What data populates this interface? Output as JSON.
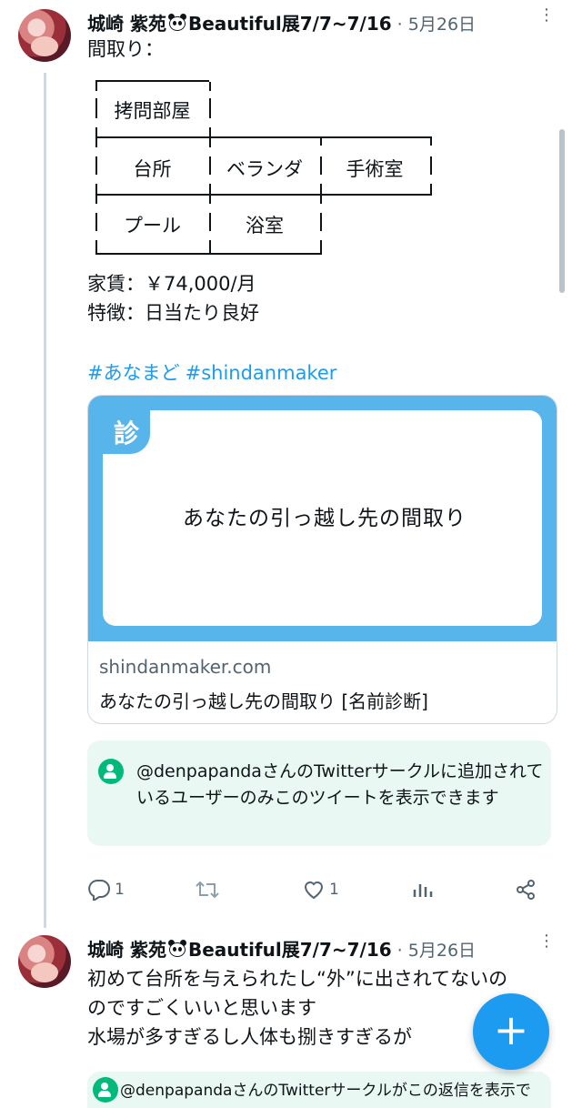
{
  "tweet1": {
    "author": "城崎 紫苑",
    "author_suffix": "Beautiful展7/7~7/16",
    "date": "5月26日",
    "intro": "間取り：",
    "rooms": {
      "torture": "拷問部屋",
      "kitchen": "台所",
      "veranda": "ベランダ",
      "surgery": "手術室",
      "pool": "プール",
      "bathroom": "浴室"
    },
    "rent": "家賃：￥74,000/月",
    "feature": "特徴：日当たり良好",
    "hashtags": [
      "#あなまど",
      "#shindanmaker"
    ],
    "card": {
      "badge": "診",
      "title": "あなたの引っ越し先の間取り",
      "domain": "shindanmaker.com",
      "description": "あなたの引っ越し先の間取り [名前診断]"
    },
    "circle_notice": "@denpapandaさんのTwitterサークルに追加されているユーザーのみこのツイートを表示できます",
    "actions": {
      "replies": "1",
      "retweets": "",
      "likes": "1"
    }
  },
  "tweet2": {
    "author": "城崎 紫苑",
    "author_suffix": "Beautiful展7/7~7/16",
    "date": "5月26日",
    "text_lines": [
      "初めて台所を与えられたし“外”に出されてないの",
      "のですごくいいと思います",
      "水場が多すぎるし人体も捌きすぎるが"
    ],
    "circle_notice": "@denpapandaさんのTwitterサークルがこの返信を表示で"
  },
  "fab": {
    "label": "+"
  },
  "colors": {
    "accent": "#1d9bf0",
    "circle_green": "#00ba7c",
    "card_blue": "#58b5eb"
  }
}
